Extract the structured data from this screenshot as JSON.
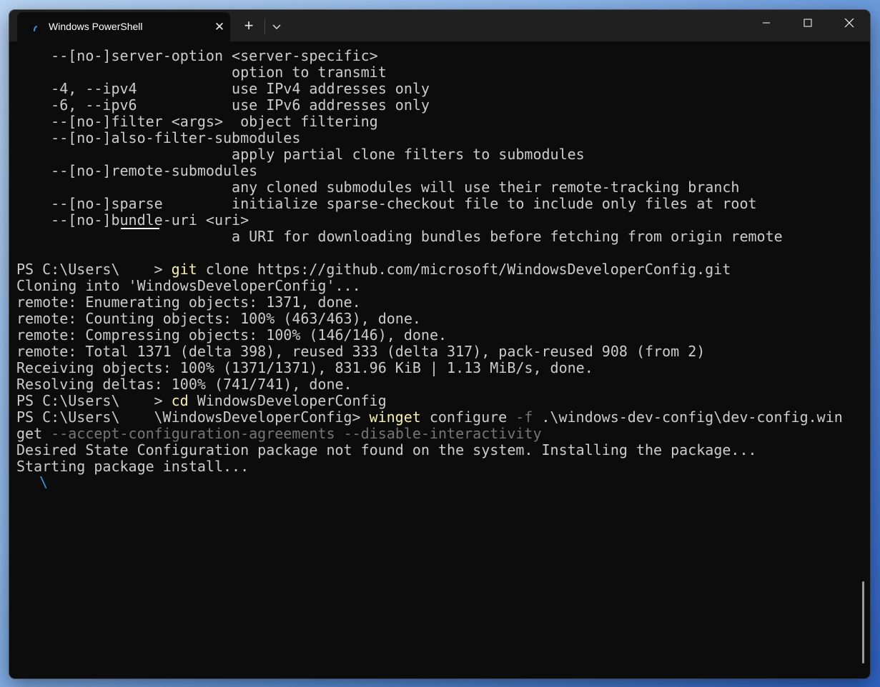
{
  "tab": {
    "title": "Windows PowerShell",
    "close_glyph": "✕",
    "new_tab_glyph": "+",
    "icons": [
      "spinner-icon",
      "close-icon",
      "plus-icon",
      "chevron-down-icon"
    ]
  },
  "window_controls": {
    "icons": [
      "minimize-icon",
      "maximize-icon",
      "close-icon"
    ]
  },
  "colors": {
    "background": "#0c0c0c",
    "text": "#cccccc",
    "command": "#f9f1a5",
    "parameter": "#767676",
    "accent": "#3a96dd"
  },
  "terminal": {
    "lines": [
      [
        {
          "t": "    --[no-]server-option <server-specific>"
        }
      ],
      [
        {
          "t": "                         option to transmit"
        }
      ],
      [
        {
          "t": "    -4, --ipv4           use IPv4 addresses only"
        }
      ],
      [
        {
          "t": "    -6, --ipv6           use IPv6 addresses only"
        }
      ],
      [
        {
          "t": "    --[no-]filter <args>  object filtering"
        }
      ],
      [
        {
          "t": "    --[no-]also-filter-submodules"
        }
      ],
      [
        {
          "t": "                         apply partial clone filters to submodules"
        }
      ],
      [
        {
          "t": "    --[no-]remote-submodules"
        }
      ],
      [
        {
          "t": "                         any cloned submodules will use their remote-tracking branch"
        }
      ],
      [
        {
          "t": "    --[no-]sparse        initialize sparse-checkout file to include only files at root"
        }
      ],
      [
        {
          "t": "    --[no-]bundle-uri <uri>"
        }
      ],
      [
        {
          "t": "                         a URI for downloading bundles before fetching from origin remote"
        }
      ],
      [
        {
          "t": ""
        }
      ],
      [
        {
          "t": "PS C:\\Users\\"
        },
        {
          "t": "",
          "c": "redact"
        },
        {
          "t": "> "
        },
        {
          "t": "git",
          "c": "cmd"
        },
        {
          "t": " clone https://github.com/microsoft/WindowsDeveloperConfig.git"
        }
      ],
      [
        {
          "t": "Cloning into 'WindowsDeveloperConfig'..."
        }
      ],
      [
        {
          "t": "remote: Enumerating objects: 1371, done."
        }
      ],
      [
        {
          "t": "remote: Counting objects: 100% (463/463), done."
        }
      ],
      [
        {
          "t": "remote: Compressing objects: 100% (146/146), done."
        }
      ],
      [
        {
          "t": "remote: Total 1371 (delta 398), reused 333 (delta 317), pack-reused 908 (from 2)"
        }
      ],
      [
        {
          "t": "Receiving objects: 100% (1371/1371), 831.96 KiB | 1.13 MiB/s, done."
        }
      ],
      [
        {
          "t": "Resolving deltas: 100% (741/741), done."
        }
      ],
      [
        {
          "t": "PS C:\\Users\\"
        },
        {
          "t": "",
          "c": "redact"
        },
        {
          "t": "> "
        },
        {
          "t": "cd",
          "c": "cmd"
        },
        {
          "t": " WindowsDeveloperConfig"
        }
      ],
      [
        {
          "t": "PS C:\\Users\\"
        },
        {
          "t": "",
          "c": "redact"
        },
        {
          "t": "\\WindowsDeveloperConfig> "
        },
        {
          "t": "winget",
          "c": "cmd"
        },
        {
          "t": " configure "
        },
        {
          "t": "-f",
          "c": "dim"
        },
        {
          "t": " .\\windows-dev-config\\dev-config.win"
        }
      ],
      [
        {
          "t": "get "
        },
        {
          "t": "--accept-configuration-agreements --disable-interactivity",
          "c": "dim"
        }
      ],
      [
        {
          "t": "Desired State Configuration package not found on the system. Installing the package..."
        }
      ],
      [
        {
          "t": "Starting package install..."
        }
      ]
    ],
    "spinner": "\\"
  }
}
